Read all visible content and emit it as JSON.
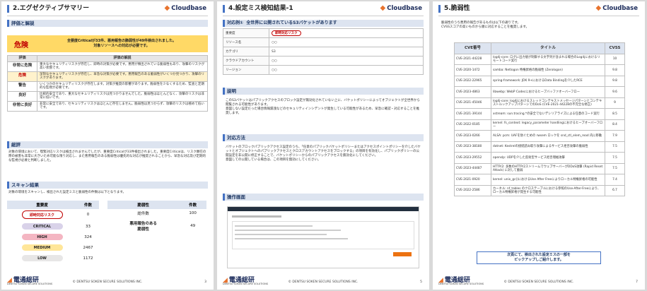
{
  "logo_text": "Cloudbase",
  "footer": {
    "company": "電通総研",
    "sub": "DENTSU SOKEN SECURE SOLUTIONS",
    "copyright": "© DENTSU SOKEN SECURE SOLUTIONS INC."
  },
  "p1": {
    "page_no": "3",
    "title": "2.エグゼクティブサマリー",
    "eval_heading": "評価と解説",
    "verdict": "危険",
    "verdict_msg": "全要度Criticalが33件、悪用報告の脆弱性が49件検出されました。\n対象リソースへの対応が必要です。",
    "eval_headers": [
      "評価",
      "評価の解説"
    ],
    "eval_rows": [
      {
        "level": "非常に危険",
        "desc": "重大なセキュリティリスクが存在し、即時の対策が必要です。悪用が頻出されている脆弱性もあり、攻撃のリスクが高い状態です。"
      },
      {
        "level": "危険",
        "desc": "深刻なセキュリティリスクが存在し、早急な対策が必要です。悪用報告のある脆弱性がいくつか見つかり、攻撃のリスクがあります。"
      },
      {
        "level": "警告",
        "desc": "いくつかのセキュリティリスクが存在します。対策が推奨の影響があります。脆弱性を少なくするため、監査と定期的な監視が必要です。"
      },
      {
        "level": "良好",
        "desc": "比較的安全であり、重大なセキュリティリスクは見つかりませんでした。脆弱性はほとんどなく、攻撃のリスクは非常に低いです。"
      },
      {
        "level": "非常に良好",
        "desc": "非常に安全であり、セキュリティリスクはほとんど存在しません。脆弱性は見つからず、攻撃のリスクは極めて低いです。"
      }
    ],
    "summary_heading": "総評",
    "summary_text": "対象の環境において、喫緊対応リスクは検出されませんでしたが、重要度Criticalが33件検出されました。重要度Criticalは、リスク顕在の際の被害も非常に大きいため可能な限り対応し、また悪用報告のある脆弱性は優先的な対応が推奨されることから、早急な対応及び定期的な監視が必要と判断しました。",
    "scan_heading": "スキャン結果",
    "scan_text": "対象の環境をスキャンし、検出された設定ミスと脆弱性の件数は以下となります。",
    "sev_headers": [
      "重要度",
      "件数"
    ],
    "sev_rows": [
      {
        "label": "即時対応リスク",
        "count": "0"
      },
      {
        "label": "CRITICAL",
        "count": "33"
      },
      {
        "label": "HIGH",
        "count": "324"
      },
      {
        "label": "MEDIUM",
        "count": "2467"
      },
      {
        "label": "LOW",
        "count": "1172"
      }
    ],
    "vuln_headers": [
      "脆弱性",
      "件数"
    ],
    "vuln_rows": [
      {
        "label": "総件数",
        "count": "100"
      },
      {
        "label": "悪用報告のある\n脆弱性",
        "count": "49"
      }
    ]
  },
  "p2": {
    "page_no": "5",
    "title": "4.設定ミス検知結果-1",
    "example_label": "対応例①",
    "example_title": "全世界に公開されているS3バケットがあります",
    "rows": [
      {
        "k": "重要度",
        "v": "即時対応リスク"
      },
      {
        "k": "リソース名",
        "v": "○○"
      },
      {
        "k": "カテゴリ",
        "v": "S3"
      },
      {
        "k": "クラウドアカウント",
        "v": "○○"
      },
      {
        "k": "リージョン",
        "v": "○○"
      }
    ],
    "desc_heading": "説明",
    "desc_text": "このS3バケットはパブリックアクセスのブロック設定が無効化されていない上に、バケットポリシーによってオブジェクトが全世界から閲覧される可能性があります。\n意図しない設定だった場合情報漏洩などのセキュリティインシデントが発生している可能性があるため、早急に確認・対応することを推奨します。",
    "fix_heading": "対応方法",
    "fix_text": "バケットのブロックパブリックアクセス設定のうち、「任意のパブリックバケットポリシーまたはアクセスポイントポリシーを介したバケットとオブジェクトへのパブリックアクセスとクロスアカウントアクセスをブロックする」の項目を有効化し、パブリックポリシーの公開設定を非公開に修正することで、バケットポリシーからのパブリックアクセスを無効化にしてください。\n意図しての公開している場合は、この項目を無効にしてください。",
    "screen_heading": "操作画面"
  },
  "p3": {
    "page_no": "7",
    "title": "5.脆弱性",
    "intro": "脆弱性のうち悪用の報告があるものは以下の通りです。\nCVSSスコアの高いものから順に対応することを推奨します。",
    "headers": [
      "CVE番号",
      "タイトル",
      "CVSS"
    ],
    "rows": [
      {
        "id": "CVE-2021-44228",
        "title": "log4j-core: ログに出力値が制御する文字列が含まれる場合のLog4jにおけるリモートコード実行",
        "score": "10"
      },
      {
        "id": "CVE-2020-1472",
        "title": "samba: Netlogon 特権昇格の脆弱性 (Zerologon)",
        "score": "9.8"
      },
      {
        "id": "CVE-2022-22965",
        "title": "spring-framework: JDK 9+におけるData Bindingを介したRCE",
        "score": "9.8"
      },
      {
        "id": "CVE-2023-4863",
        "title": "libwebp: WebP Codecにおけるヒープバッファオーバーフロー",
        "score": "9.6"
      },
      {
        "id": "CVE-2021-45046",
        "title": "log4j-core: log4jにおけるスレッドコンテキストメッセージパターンとコンテキストルックアップパターンでのDoS (CVE-2021-44228の不完全な修正)",
        "score": "9"
      },
      {
        "id": "CVE-2021-39144",
        "title": "xstream: sun.tracing.*の安全でないデシリアライズによる任意のコード実行",
        "score": "8.5"
      },
      {
        "id": "CVE-2022-0185",
        "title": "kernel: fs_context: legacy_parameter handlingにおけるヒープオーバーフロー",
        "score": "8.4"
      },
      {
        "id": "CVE-2023-0266",
        "title": "ALSA: pcm: UAFを防ぐための rwsem ロックを snd_ctl_elem_read 内に移動",
        "score": "7.9"
      },
      {
        "id": "CVE-2023-38180",
        "title": "dotnet: Kestrelの接続読み取り攻撃によるサービス拒否攻撃の脆弱性",
        "score": "7.5"
      },
      {
        "id": "CVE-2023-29552",
        "title": "openslp: UDPを介した反射型サービス拒否増幅攻撃",
        "score": "7.5"
      },
      {
        "id": "CVE-2023-44487",
        "title": "HTTP/2: 多数のHTTP/2ストリームでウェブサーバーがDDoS攻撃 (Rapid Reset Attack) に対して脆弱",
        "score": "7.5"
      },
      {
        "id": "CVE-2021-0920",
        "title": "kernel: unix_gc()におけるUse After Freeによりローカル特権昇格の可能性",
        "score": "7.4"
      },
      {
        "id": "CVE-2022-2586",
        "title": "カーネル: nf_tables のクロステーブルにおける参照のUse-After-Freeにより、ローカル特権昇格が発生する可能性",
        "score": "6.7"
      }
    ],
    "note": "次頁にて、検出された設定ミスの一部を\nピックアップしご紹介します。"
  }
}
